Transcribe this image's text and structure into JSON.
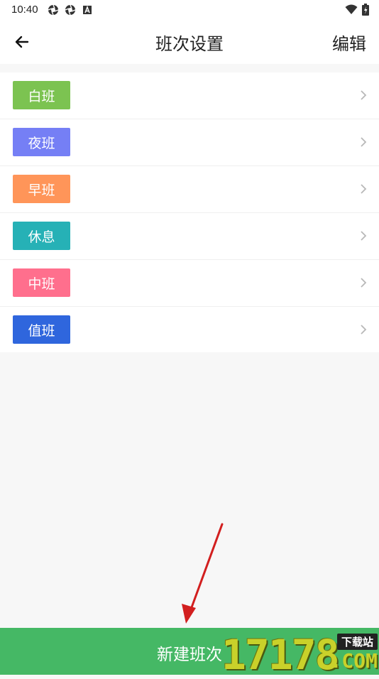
{
  "status_bar": {
    "time": "10:40",
    "left_icons": [
      "shutter-icon",
      "shutter-icon",
      "android-a-icon"
    ],
    "right_icons": [
      "wifi-icon",
      "battery-icon"
    ]
  },
  "header": {
    "back_icon": "arrow-left-icon",
    "title": "班次设置",
    "edit_label": "编辑"
  },
  "shifts": [
    {
      "label": "白班",
      "color": "#7cc351"
    },
    {
      "label": "夜班",
      "color": "#757ff5"
    },
    {
      "label": "早班",
      "color": "#ff9559"
    },
    {
      "label": "休息",
      "color": "#26b1b6"
    },
    {
      "label": "中班",
      "color": "#ff6f8d"
    },
    {
      "label": "值班",
      "color": "#2f66dd"
    }
  ],
  "bottom_button": {
    "label": "新建班次",
    "color": "#45b865"
  },
  "watermark": {
    "digits": "17178",
    "badge": "下载站",
    "suffix": ".COM"
  },
  "annotation": {
    "arrow_color": "#d21f1f"
  }
}
